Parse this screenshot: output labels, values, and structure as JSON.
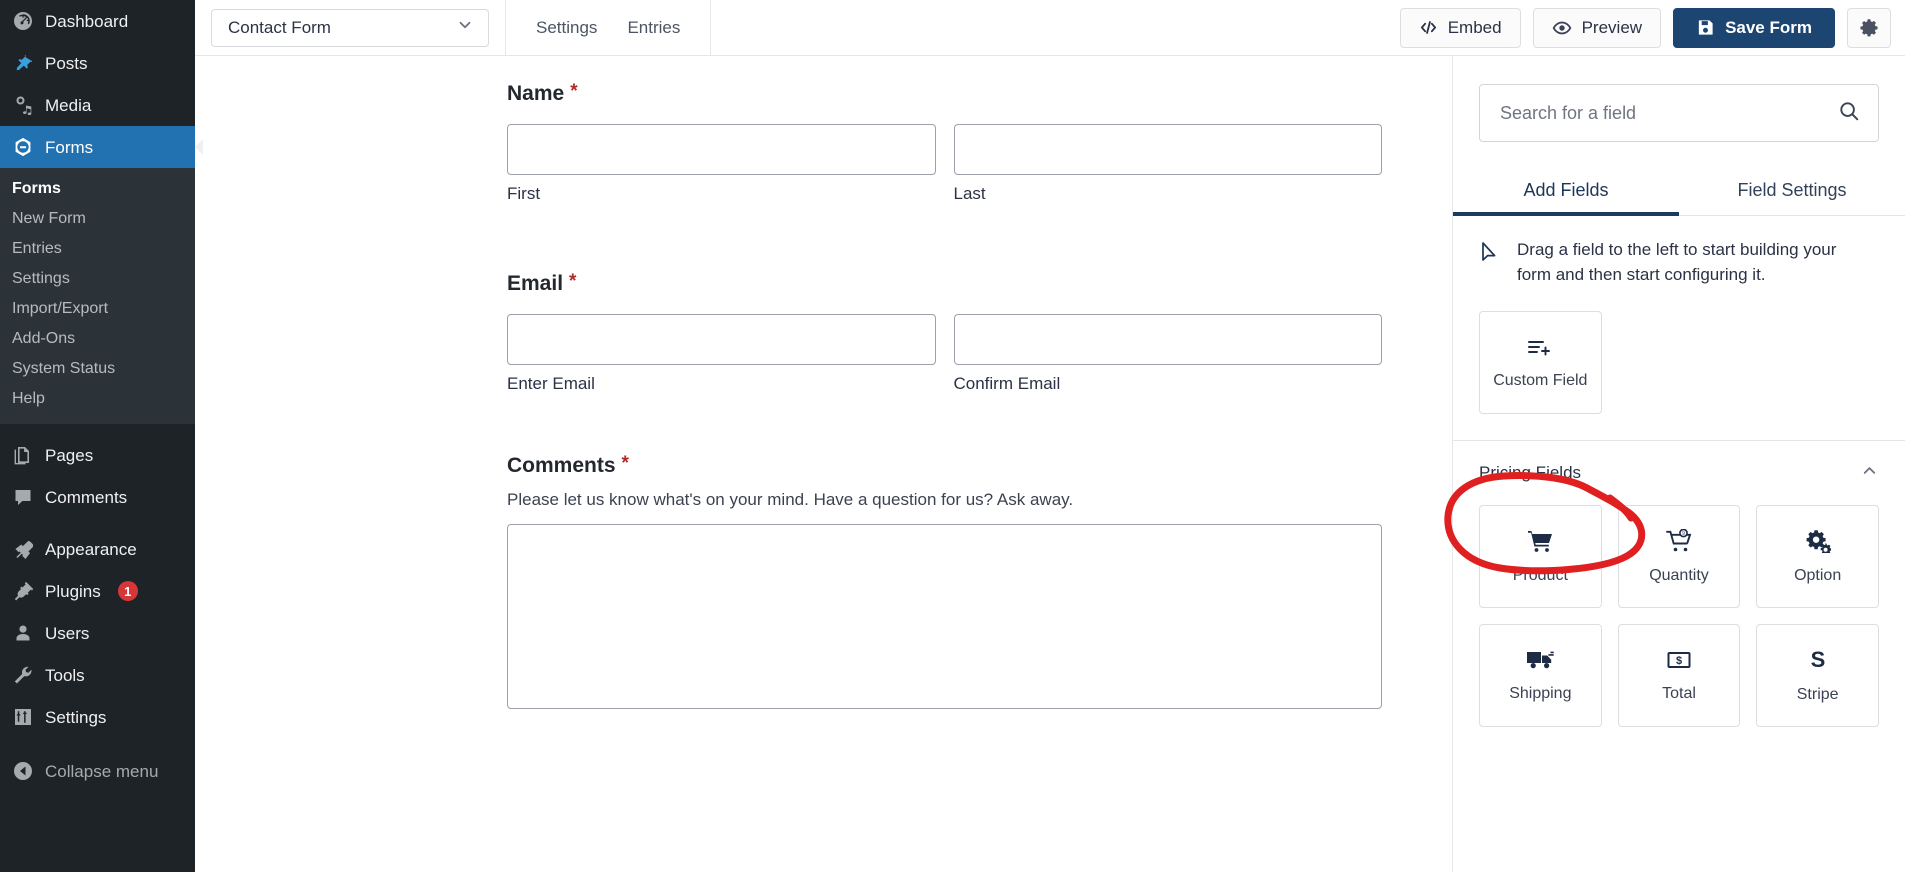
{
  "wp_sidebar": {
    "items": [
      {
        "label": "Dashboard",
        "icon": "dashboard-icon"
      },
      {
        "label": "Posts",
        "icon": "posts-pin-icon"
      },
      {
        "label": "Media",
        "icon": "media-icon"
      },
      {
        "label": "Forms",
        "icon": "forms-icon",
        "current": true
      }
    ],
    "submenu": [
      {
        "label": "Forms",
        "active": true
      },
      {
        "label": "New Form"
      },
      {
        "label": "Entries"
      },
      {
        "label": "Settings"
      },
      {
        "label": "Import/Export"
      },
      {
        "label": "Add-Ons"
      },
      {
        "label": "System Status"
      },
      {
        "label": "Help"
      }
    ],
    "items_bottom": [
      {
        "label": "Pages",
        "icon": "pages-icon"
      },
      {
        "label": "Comments",
        "icon": "comments-icon"
      }
    ],
    "items_bottom2": [
      {
        "label": "Appearance",
        "icon": "appearance-brush-icon"
      },
      {
        "label": "Plugins",
        "icon": "plugins-plug-icon",
        "badge": "1"
      },
      {
        "label": "Users",
        "icon": "users-icon"
      },
      {
        "label": "Tools",
        "icon": "tools-wrench-icon"
      },
      {
        "label": "Settings",
        "icon": "settings-sliders-icon"
      }
    ],
    "collapse": {
      "label": "Collapse menu",
      "icon": "collapse-arrow-icon"
    }
  },
  "topbar": {
    "form_select_value": "Contact Form",
    "tabs": [
      {
        "label": "Settings"
      },
      {
        "label": "Entries"
      }
    ],
    "embed_label": "Embed",
    "preview_label": "Preview",
    "save_label": "Save Form",
    "settings_gear": "gear-icon"
  },
  "form": {
    "fields": [
      {
        "label": "Name",
        "required_mark": "*",
        "sub": [
          "First",
          "Last"
        ]
      },
      {
        "label": "Email",
        "required_mark": "*",
        "sub": [
          "Enter Email",
          "Confirm Email"
        ]
      },
      {
        "label": "Comments",
        "required_mark": "*",
        "description": "Please let us know what's on your mind. Have a question for us? Ask away."
      }
    ]
  },
  "right_panel": {
    "search": {
      "placeholder": "Search for a field",
      "value": "",
      "icon": "search-icon"
    },
    "tabs": [
      {
        "label": "Add Fields",
        "active": true
      },
      {
        "label": "Field Settings",
        "active": false
      }
    ],
    "hint": {
      "text": "Drag a field to the left to start building your form and then start configuring it.",
      "icon": "cursor-arrow-icon"
    },
    "advanced_cards": [
      {
        "label": "Custom Field",
        "icon": "custom-field-icon"
      }
    ],
    "pricing_section": {
      "title": "Pricing Fields",
      "collapse_icon": "chevron-up-icon",
      "cards": [
        {
          "label": "Product",
          "icon": "shopping-cart-icon"
        },
        {
          "label": "Quantity",
          "icon": "cart-quantity-icon"
        },
        {
          "label": "Option",
          "icon": "gears-icon"
        },
        {
          "label": "Shipping",
          "icon": "truck-icon"
        },
        {
          "label": "Total",
          "icon": "money-total-icon"
        },
        {
          "label": "Stripe",
          "icon": "stripe-s-icon"
        }
      ]
    }
  },
  "annotation": {
    "shape": "hand-drawn-ellipse",
    "color": "#e02020",
    "target": "Pricing Fields"
  }
}
